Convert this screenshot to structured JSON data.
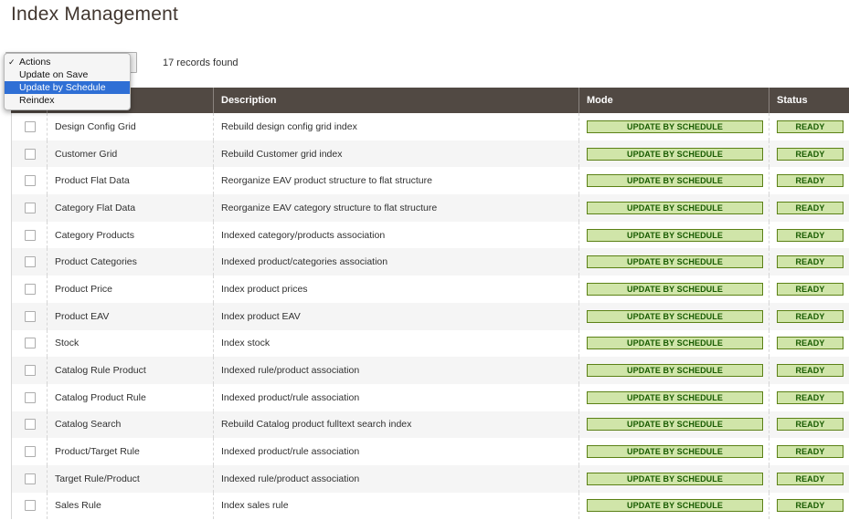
{
  "page": {
    "title": "Index Management"
  },
  "toolbar": {
    "records_found": "17 records found"
  },
  "actions_menu": {
    "items": [
      {
        "label": "Actions",
        "checked": true
      },
      {
        "label": "Update on Save",
        "checked": false
      },
      {
        "label": "Update by Schedule",
        "checked": false,
        "highlighted": true
      },
      {
        "label": "Reindex",
        "checked": false
      }
    ]
  },
  "grid": {
    "columns": {
      "indexer": "",
      "description": "Description",
      "mode": "Mode",
      "status": "Status"
    },
    "rows": [
      {
        "title": "Design Config Grid",
        "description": "Rebuild design config grid index",
        "mode": "UPDATE BY SCHEDULE",
        "status": "READY"
      },
      {
        "title": "Customer Grid",
        "description": "Rebuild Customer grid index",
        "mode": "UPDATE BY SCHEDULE",
        "status": "READY"
      },
      {
        "title": "Product Flat Data",
        "description": "Reorganize EAV product structure to flat structure",
        "mode": "UPDATE BY SCHEDULE",
        "status": "READY"
      },
      {
        "title": "Category Flat Data",
        "description": "Reorganize EAV category structure to flat structure",
        "mode": "UPDATE BY SCHEDULE",
        "status": "READY"
      },
      {
        "title": "Category Products",
        "description": "Indexed category/products association",
        "mode": "UPDATE BY SCHEDULE",
        "status": "READY"
      },
      {
        "title": "Product Categories",
        "description": "Indexed product/categories association",
        "mode": "UPDATE BY SCHEDULE",
        "status": "READY"
      },
      {
        "title": "Product Price",
        "description": "Index product prices",
        "mode": "UPDATE BY SCHEDULE",
        "status": "READY"
      },
      {
        "title": "Product EAV",
        "description": "Index product EAV",
        "mode": "UPDATE BY SCHEDULE",
        "status": "READY"
      },
      {
        "title": "Stock",
        "description": "Index stock",
        "mode": "UPDATE BY SCHEDULE",
        "status": "READY"
      },
      {
        "title": "Catalog Rule Product",
        "description": "Indexed rule/product association",
        "mode": "UPDATE BY SCHEDULE",
        "status": "READY"
      },
      {
        "title": "Catalog Product Rule",
        "description": "Indexed product/rule association",
        "mode": "UPDATE BY SCHEDULE",
        "status": "READY"
      },
      {
        "title": "Catalog Search",
        "description": "Rebuild Catalog product fulltext search index",
        "mode": "UPDATE BY SCHEDULE",
        "status": "READY"
      },
      {
        "title": "Product/Target Rule",
        "description": "Indexed product/rule association",
        "mode": "UPDATE BY SCHEDULE",
        "status": "READY"
      },
      {
        "title": "Target Rule/Product",
        "description": "Indexed rule/product association",
        "mode": "UPDATE BY SCHEDULE",
        "status": "READY"
      },
      {
        "title": "Sales Rule",
        "description": "Index sales rule",
        "mode": "UPDATE BY SCHEDULE",
        "status": "READY"
      }
    ]
  },
  "colors": {
    "header_bg": "#514943",
    "badge_bg": "#d0e5a9",
    "badge_border": "#5b8116",
    "badge_text": "#185b00",
    "menu_highlight": "#2f6fd5"
  }
}
